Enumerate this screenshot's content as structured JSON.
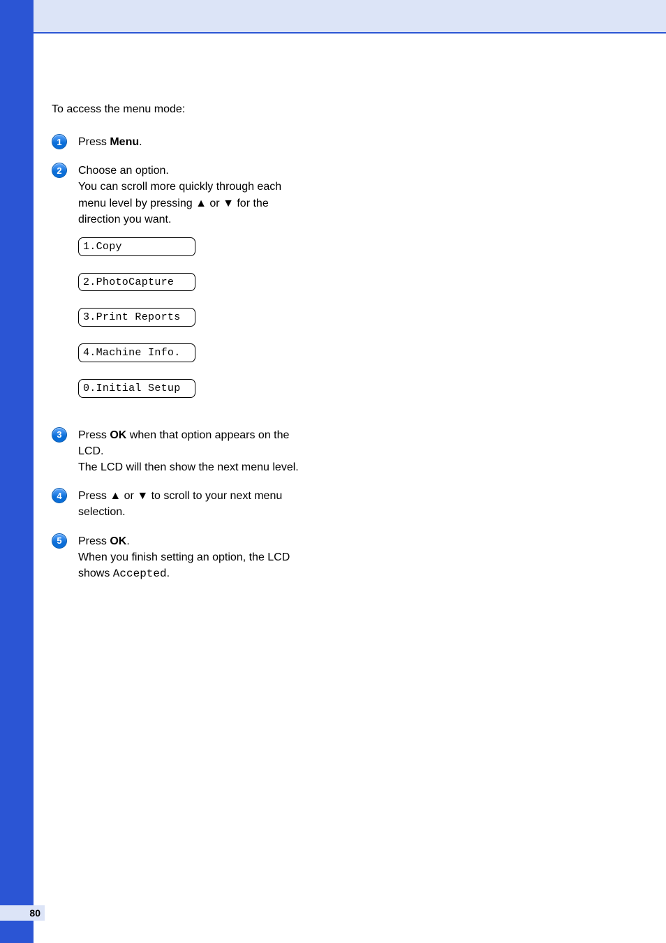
{
  "intro_text": "To access the menu mode:",
  "steps": [
    {
      "num": "1",
      "pre": "Press ",
      "bold": "Menu",
      "post": "."
    },
    {
      "num": "2",
      "text_a": "Choose an option.",
      "text_b_pre": "You can scroll more quickly through each menu level by pressing ",
      "text_b_up": "a",
      "text_b_mid": " or ",
      "text_b_down": "b",
      "text_b_post": " for the direction you want.",
      "lcds": [
        "1.Copy",
        "2.PhotoCapture",
        "3.Print Reports",
        "4.Machine Info.",
        "0.Initial Setup"
      ]
    },
    {
      "num": "3",
      "pre": "Press ",
      "bold": "OK",
      "post_a": " when that option appears on the LCD.",
      "line2": "The LCD will then show the next menu level."
    },
    {
      "num": "4",
      "pre": "Press ",
      "up": "a",
      "mid": " or ",
      "down": "b",
      "post": " to scroll to your next menu selection."
    },
    {
      "num": "5",
      "pre": "Press ",
      "bold": "OK",
      "post_a": ".",
      "line2_pre": "When you finish setting an option, the LCD shows ",
      "line2_mono": "Accepted",
      "line2_post": "."
    }
  ],
  "arrows": {
    "up": "▲",
    "down": "▼"
  },
  "page_number": "80"
}
